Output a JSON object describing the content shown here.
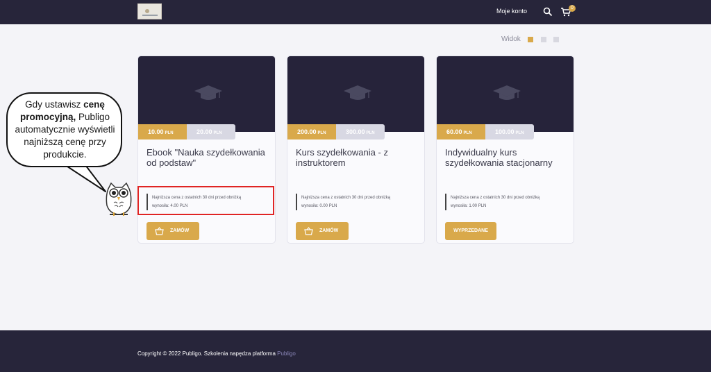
{
  "header": {
    "account_label": "Moje konto",
    "cart_count": "0"
  },
  "view": {
    "label": "Widok"
  },
  "products": [
    {
      "title": "Ebook \"Nauka szydełkowania od podstaw\"",
      "promo_price": "10.00",
      "regular_price": "20.00",
      "currency": "PLN",
      "lowest_line1": "Najniższa cena z ostatnich 30 dni przed obniżką",
      "lowest_line2": "wynosiła: 4.00 PLN",
      "button_label": "ZAMÓW"
    },
    {
      "title": "Kurs szydełkowania - z instruktorem",
      "promo_price": "200.00",
      "regular_price": "300.00",
      "currency": "PLN",
      "lowest_line1": "Najniższa cena z ostatnich 30 dni przed obniżką",
      "lowest_line2": "wynosiła: 0.00 PLN",
      "button_label": "ZAMÓW"
    },
    {
      "title": "Indywidualny kurs szydełkowania stacjonarny",
      "promo_price": "60.00",
      "regular_price": "100.00",
      "currency": "PLN",
      "lowest_line1": "Najniższa cena z ostatnich 30 dni przed obniżką",
      "lowest_line2": "wynosiła: 1.00 PLN",
      "button_label": "WYPRZEDANE"
    }
  ],
  "callout": {
    "text_1": "Gdy ustawisz ",
    "text_bold": "cenę promocyjną,",
    "text_2": " Publigo automatycznie wyświetli najniższą cenę przy produkcie."
  },
  "footer": {
    "copyright": "Copyright © 2022 Publigo. Szkolenia napędza platforma ",
    "brand": "Publigo"
  },
  "colors": {
    "accent": "#d9a94b",
    "dark": "#27253a",
    "highlight": "#e02424"
  }
}
